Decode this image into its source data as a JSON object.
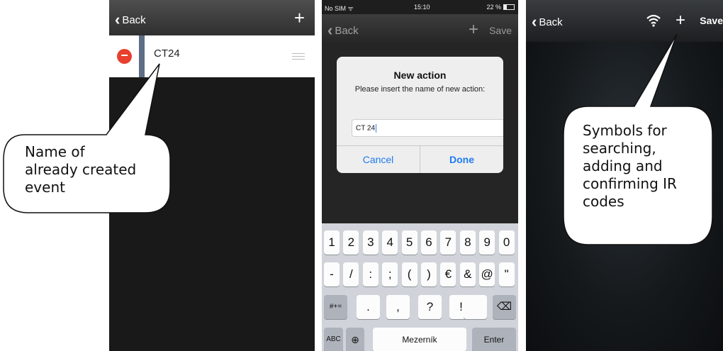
{
  "screen1": {
    "back_label": "Back",
    "add_icon": "plus-icon",
    "item_label": "CT24"
  },
  "screen2": {
    "status": {
      "carrier": "No SIM ᯤ",
      "time": "15:10",
      "battery": "22 %"
    },
    "back_label": "Back",
    "save_label": "Save",
    "dialog": {
      "title": "New action",
      "message": "Please insert the name of new action:",
      "input_value": "CT 24",
      "cancel_label": "Cancel",
      "done_label": "Done"
    },
    "keyboard": {
      "row1": [
        "1",
        "2",
        "3",
        "4",
        "5",
        "6",
        "7",
        "8",
        "9",
        "0"
      ],
      "row2": [
        "-",
        "/",
        ":",
        ";",
        "(",
        ")",
        "€",
        "&",
        "@",
        "\""
      ],
      "row3_mode": "#+=",
      "row3": [
        ".",
        ",",
        "?",
        "!",
        "’"
      ],
      "abc_label": "ABC",
      "space_label": "Mezerník",
      "enter_label": "Enter"
    }
  },
  "screen3": {
    "back_label": "Back",
    "save_label": "Save"
  },
  "callouts": {
    "left": [
      "Name of",
      "already created",
      "event"
    ],
    "right": [
      "Symbols for",
      "searching,",
      "adding and",
      "confirming IR",
      "codes"
    ]
  }
}
